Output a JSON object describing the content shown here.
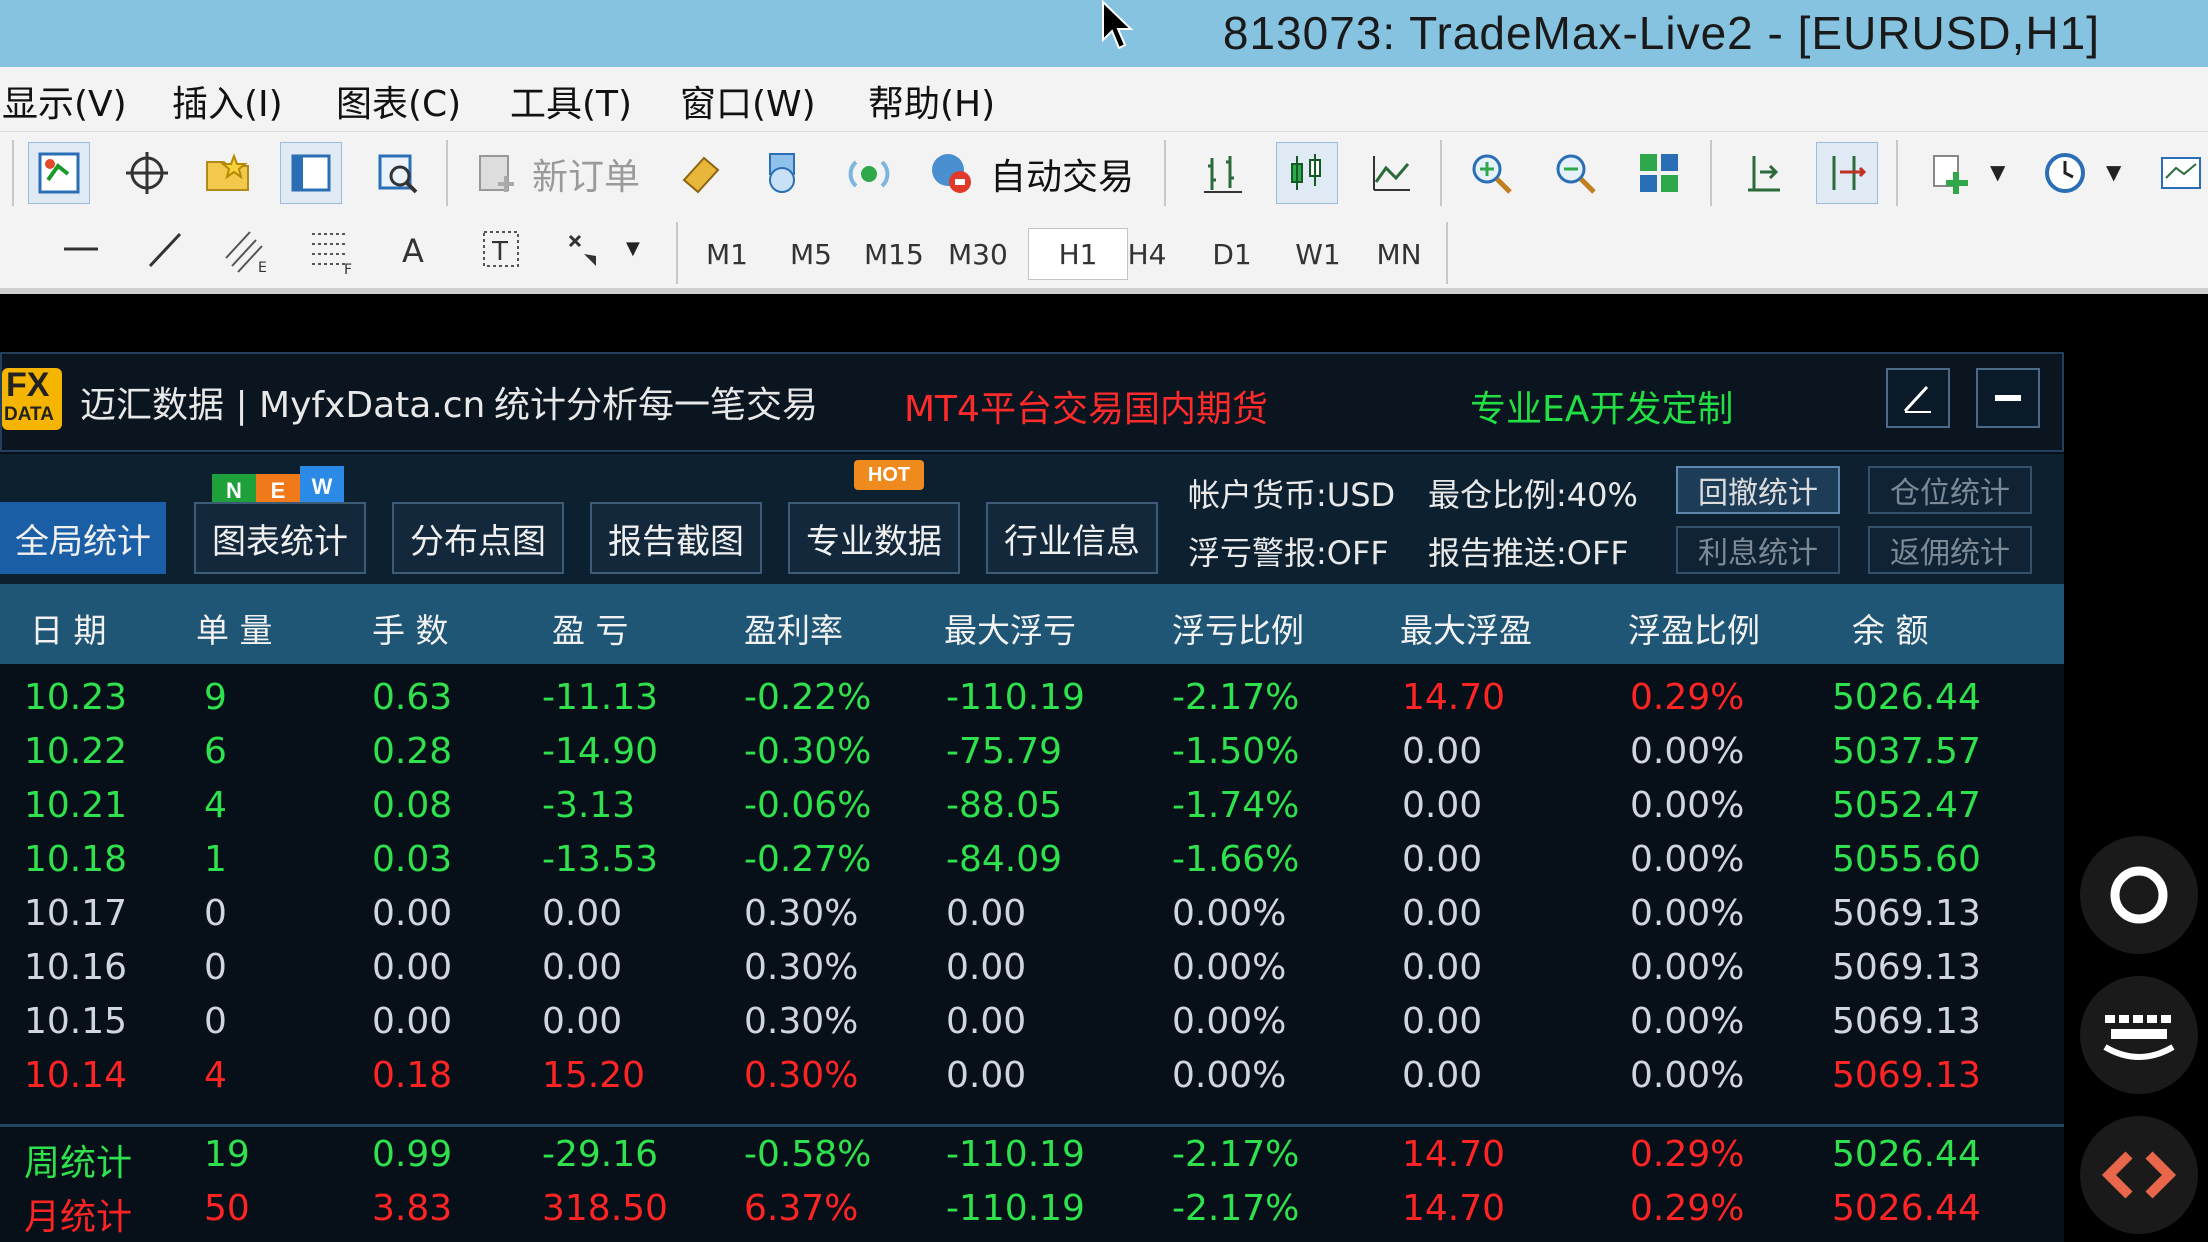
{
  "window": {
    "title": "813073: TradeMax-Live2 - [EURUSD,H1]"
  },
  "menu": [
    "显示(V)",
    "插入(I)",
    "图表(C)",
    "工具(T)",
    "窗口(W)",
    "帮助(H)"
  ],
  "toolbar": {
    "new_order": "新订单",
    "auto_trading": "自动交易"
  },
  "timeframes": [
    "M1",
    "M5",
    "M15",
    "M30",
    "H1",
    "H4",
    "D1",
    "W1",
    "MN"
  ],
  "timeframe_selected": "H1",
  "panel": {
    "logo_fx": "FX",
    "logo_data": "DATA",
    "brand": "迈汇数据 | MyfxData.cn",
    "slogan": "统计分析每一笔交易",
    "promo_red": "MT4平台交易国内期货",
    "promo_green": "专业EA开发定制"
  },
  "tabs": [
    "全局统计",
    "图表统计",
    "分布点图",
    "报告截图",
    "专业数据",
    "行业信息"
  ],
  "badges": {
    "n": "N",
    "e": "E",
    "w": "W",
    "hot": "HOT"
  },
  "account_info": {
    "currency": "帐户货币:USD",
    "margin_ratio": "最仓比例:40%",
    "float_alert": "浮亏警报:OFF",
    "report_push": "报告推送:OFF"
  },
  "stat_buttons": [
    "回撤统计",
    "仓位统计",
    "利息统计",
    "返佣统计"
  ],
  "columns": [
    "日 期",
    "单 量",
    "手 数",
    "盈 亏",
    "盈利率",
    "最大浮亏",
    "浮亏比例",
    "最大浮盈",
    "浮盈比例",
    "余 额"
  ],
  "rows": [
    {
      "date": "10.23",
      "orders": "9",
      "lots": "0.63",
      "pnl": "-11.13",
      "rate": "-0.22%",
      "max_float_loss": "-110.19",
      "float_loss_ratio": "-2.17%",
      "max_float_profit": "14.70",
      "float_profit_ratio": "0.29%",
      "balance": "5026.44"
    },
    {
      "date": "10.22",
      "orders": "6",
      "lots": "0.28",
      "pnl": "-14.90",
      "rate": "-0.30%",
      "max_float_loss": "-75.79",
      "float_loss_ratio": "-1.50%",
      "max_float_profit": "0.00",
      "float_profit_ratio": "0.00%",
      "balance": "5037.57"
    },
    {
      "date": "10.21",
      "orders": "4",
      "lots": "0.08",
      "pnl": "-3.13",
      "rate": "-0.06%",
      "max_float_loss": "-88.05",
      "float_loss_ratio": "-1.74%",
      "max_float_profit": "0.00",
      "float_profit_ratio": "0.00%",
      "balance": "5052.47"
    },
    {
      "date": "10.18",
      "orders": "1",
      "lots": "0.03",
      "pnl": "-13.53",
      "rate": "-0.27%",
      "max_float_loss": "-84.09",
      "float_loss_ratio": "-1.66%",
      "max_float_profit": "0.00",
      "float_profit_ratio": "0.00%",
      "balance": "5055.60"
    },
    {
      "date": "10.17",
      "orders": "0",
      "lots": "0.00",
      "pnl": "0.00",
      "rate": "0.30%",
      "max_float_loss": "0.00",
      "float_loss_ratio": "0.00%",
      "max_float_profit": "0.00",
      "float_profit_ratio": "0.00%",
      "balance": "5069.13"
    },
    {
      "date": "10.16",
      "orders": "0",
      "lots": "0.00",
      "pnl": "0.00",
      "rate": "0.30%",
      "max_float_loss": "0.00",
      "float_loss_ratio": "0.00%",
      "max_float_profit": "0.00",
      "float_profit_ratio": "0.00%",
      "balance": "5069.13"
    },
    {
      "date": "10.15",
      "orders": "0",
      "lots": "0.00",
      "pnl": "0.00",
      "rate": "0.30%",
      "max_float_loss": "0.00",
      "float_loss_ratio": "0.00%",
      "max_float_profit": "0.00",
      "float_profit_ratio": "0.00%",
      "balance": "5069.13"
    },
    {
      "date": "10.14",
      "orders": "4",
      "lots": "0.18",
      "pnl": "15.20",
      "rate": "0.30%",
      "max_float_loss": "0.00",
      "float_loss_ratio": "0.00%",
      "max_float_profit": "0.00",
      "float_profit_ratio": "0.00%",
      "balance": "5069.13"
    }
  ],
  "summary": [
    {
      "date": "周统计",
      "orders": "19",
      "lots": "0.99",
      "pnl": "-29.16",
      "rate": "-0.58%",
      "max_float_loss": "-110.19",
      "float_loss_ratio": "-2.17%",
      "max_float_profit": "14.70",
      "float_profit_ratio": "0.29%",
      "balance": "5026.44"
    },
    {
      "date": "月统计",
      "orders": "50",
      "lots": "3.83",
      "pnl": "318.50",
      "rate": "6.37%",
      "max_float_loss": "-110.19",
      "float_loss_ratio": "-2.17%",
      "max_float_profit": "14.70",
      "float_profit_ratio": "0.29%",
      "balance": "5026.44"
    }
  ],
  "colors": {
    "green": "#2fe24d",
    "red": "#ff2424",
    "white": "#cfd6dd",
    "header_blue": "#1f5575",
    "tab_active": "#1a5fa6"
  }
}
